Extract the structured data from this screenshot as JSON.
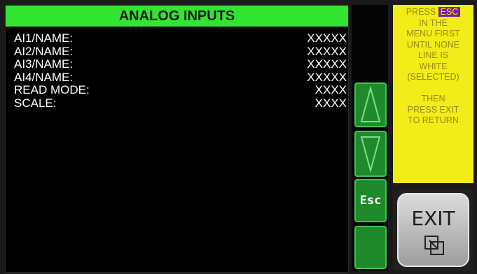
{
  "screen": {
    "title": "ANALOG INPUTS",
    "rows": [
      {
        "label": "AI1/NAME:",
        "value": "XXXXX"
      },
      {
        "label": "AI2/NAME:",
        "value": "XXXXX"
      },
      {
        "label": "AI3/NAME:",
        "value": "XXXXX"
      },
      {
        "label": "AI4/NAME:",
        "value": "XXXXX"
      },
      {
        "label": "READ MODE:",
        "value": "XXXX"
      },
      {
        "label": "SCALE:",
        "value": "XXXX"
      }
    ]
  },
  "side_buttons": {
    "up_icon": "triangle-up-icon",
    "down_icon": "triangle-down-icon",
    "esc_label": "Esc"
  },
  "info": {
    "press": "PRESS",
    "esc": "ESC",
    "lines": [
      "IN THE",
      "MENU FIRST",
      "UNTIL NONE",
      "LINE IS",
      "WHITE",
      "(SELECTED)",
      "",
      "THEN",
      "PRESS EXIT",
      "TO RETURN"
    ]
  },
  "exit": {
    "label": "EXIT",
    "icon": "exit-squares-icon"
  },
  "colors": {
    "title_bar": "#33e433",
    "button_green": "#1f8a2c",
    "info_yellow": "#f2ec18",
    "esc_purple": "#7a1f9a"
  }
}
